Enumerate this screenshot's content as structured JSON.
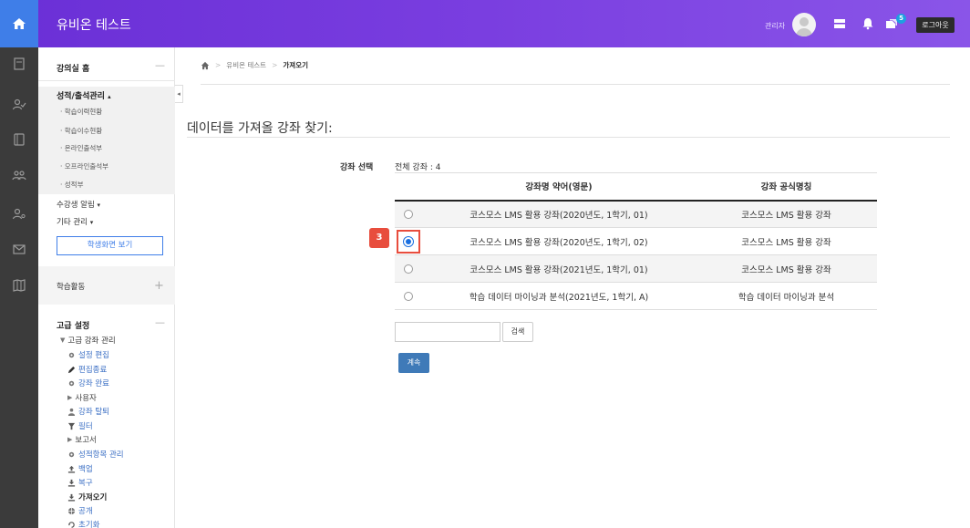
{
  "header": {
    "site_title": "유비온 테스트",
    "admin_label": "관리자",
    "notification_count": "5",
    "logout_label": "로그아웃"
  },
  "sidebar": {
    "classroom_home": "강의실 홈",
    "grades_attendance": "성적/출석관리",
    "grades_sub": [
      "학습이력현황",
      "학습이수현황",
      "온라인출석부",
      "오프라인출석부",
      "성적부"
    ],
    "student_notify": "수강생 알림",
    "other_manage": "기타 관리",
    "student_view_button": "학생화면 보기",
    "learning_activity": "학습활동",
    "advanced_settings": "고급 설정",
    "advanced_course_manage": "고급 강좌 관리",
    "advanced_items": [
      "설정 편집",
      "편집종료",
      "강좌 완료",
      "사용자",
      "강좌 탈퇴",
      "필터",
      "보고서",
      "성적항목 관리",
      "백업",
      "복구",
      "가져오기",
      "공개",
      "초기화"
    ]
  },
  "breadcrumb": {
    "course": "유비온 테스트",
    "current": "가져오기"
  },
  "main": {
    "heading": "데이터를 가져올 강좌 찾기:",
    "field_label": "강좌 선택",
    "total_label": "전체 강좌 : 4",
    "table_headers": [
      "강좌명 약어(영문)",
      "강좌 공식명칭"
    ],
    "rows": [
      {
        "short": "코스모스 LMS 활용 강좌(2020년도, 1학기, 01)",
        "full": "코스모스 LMS 활용 강좌",
        "selected": false
      },
      {
        "short": "코스모스 LMS 활용 강좌(2020년도, 1학기, 02)",
        "full": "코스모스 LMS 활용 강좌",
        "selected": true
      },
      {
        "short": "코스모스 LMS 활용 강좌(2021년도, 1학기, 01)",
        "full": "코스모스 LMS 활용 강좌",
        "selected": false
      },
      {
        "short": "학습 데이터 마이닝과 분석(2021년도, 1학기, A)",
        "full": "학습 데이터 마이닝과 분석",
        "selected": false
      }
    ],
    "search_value": "",
    "search_button": "검색",
    "continue_button": "계속",
    "step_marker": "3"
  },
  "colors": {
    "header_purple": "#7a3ee0",
    "home_blue": "#3f7ee8",
    "rail_dark": "#3b3b3b",
    "highlight_red": "#e84d3d",
    "primary_button": "#3f7ab8"
  }
}
